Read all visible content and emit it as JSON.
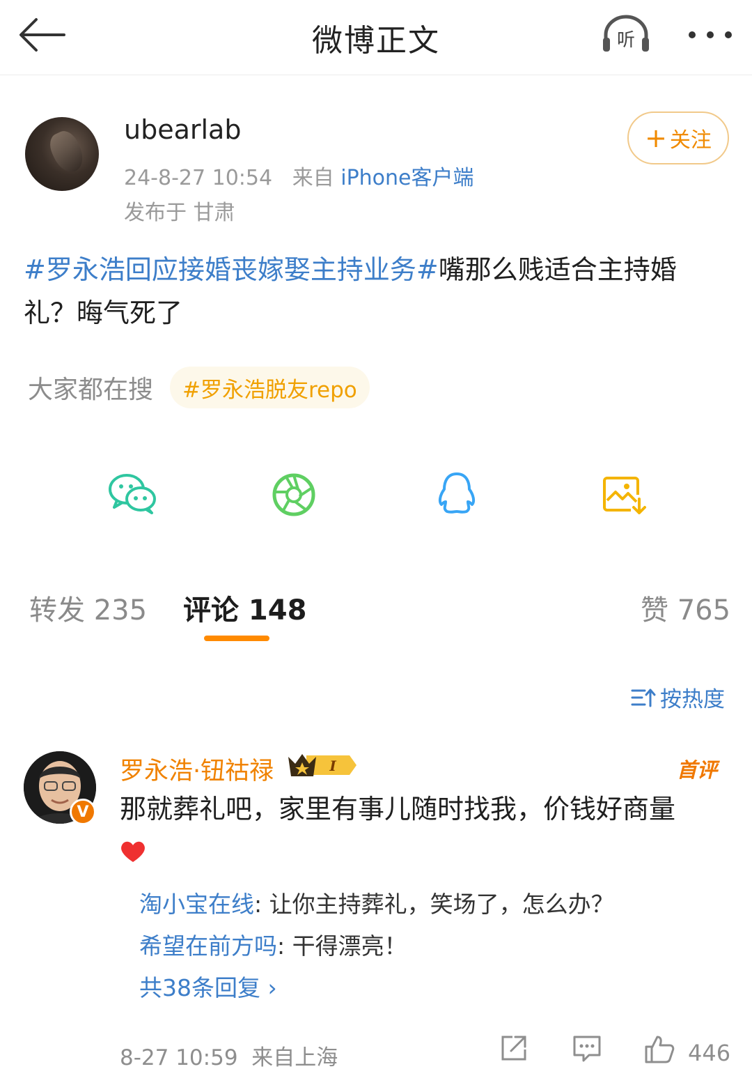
{
  "nav": {
    "title": "微博正文",
    "listen_label": "听"
  },
  "author": {
    "name": "ubearlab",
    "time": "24-8-27 10:54",
    "source_prefix": "来自",
    "source": "iPhone客户端",
    "location": "发布于 甘肃",
    "follow_label": "关注"
  },
  "post": {
    "topic": "#罗永浩回应接婚丧嫁娶主持业务#",
    "text": "嘴那么贱适合主持婚礼？晦气死了"
  },
  "search": {
    "label": "大家都在搜",
    "tag": "#罗永浩脱友repo"
  },
  "share": [
    "wechat-icon",
    "moments-icon",
    "qq-icon",
    "save-image-icon"
  ],
  "tabs": {
    "repost": "转发 235",
    "comment": "评论 148",
    "like": "赞 765"
  },
  "sort": {
    "label": "按热度"
  },
  "comment": {
    "name": "罗永浩·钮祜禄",
    "vip_level": "I",
    "verified": "V",
    "first_label": "首评",
    "text": "那就葬礼吧，家里有事儿随时找我，价钱好商量",
    "replies": [
      {
        "name": "淘小宝在线",
        "text": ": 让你主持葬礼，笑场了，怎么办？"
      },
      {
        "name": "希望在前方吗",
        "text": ": 干得漂亮！"
      }
    ],
    "total_replies": "共38条回复 ›",
    "time": "8-27 10:59",
    "location": "来自上海",
    "likes": "446"
  },
  "colors": {
    "accent": "#ff8a00",
    "link": "#3d7ec9",
    "muted": "#9a9a9a"
  }
}
